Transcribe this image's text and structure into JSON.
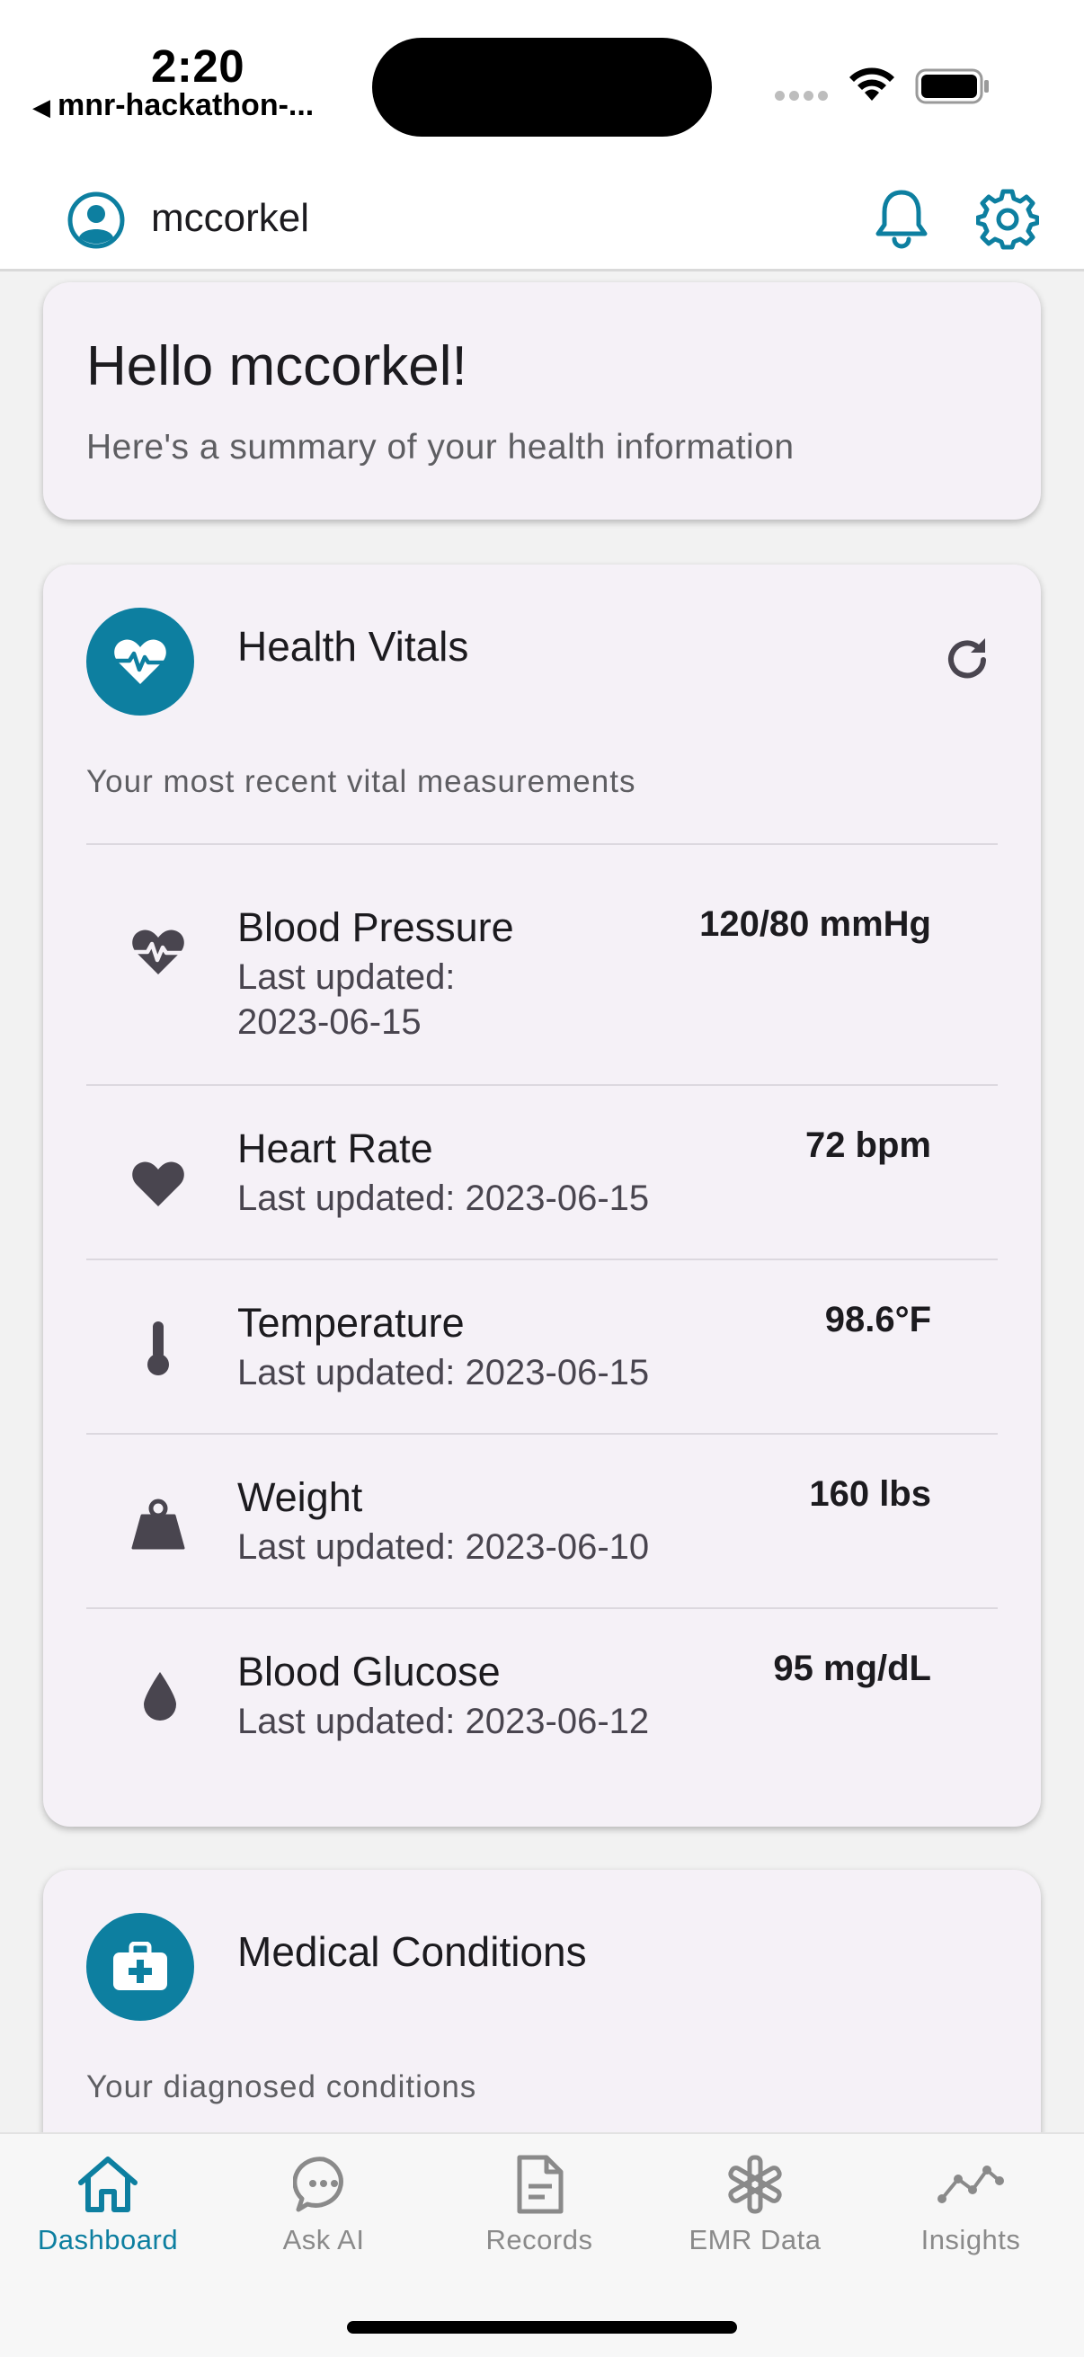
{
  "status_bar": {
    "time": "2:20",
    "back_app": "mnr-hackathon-..."
  },
  "header": {
    "username": "mccorkel"
  },
  "greeting": {
    "title": "Hello mccorkel!",
    "subtitle": "Here's a summary of your health information"
  },
  "vitals": {
    "title": "Health Vitals",
    "subtitle": "Your most recent vital measurements",
    "items": [
      {
        "name": "Blood Pressure",
        "updated_line1": "Last updated:",
        "updated_line2": "2023-06-15",
        "value": "120/80 mmHg",
        "icon": "heart-pulse-icon"
      },
      {
        "name": "Heart Rate",
        "updated": "Last updated: 2023-06-15",
        "value": "72 bpm",
        "icon": "heart-icon"
      },
      {
        "name": "Temperature",
        "updated": "Last updated: 2023-06-15",
        "value": "98.6°F",
        "icon": "thermometer-icon"
      },
      {
        "name": "Weight",
        "updated": "Last updated: 2023-06-10",
        "value": "160 lbs",
        "icon": "weight-icon"
      },
      {
        "name": "Blood Glucose",
        "updated": "Last updated: 2023-06-12",
        "value": "95 mg/dL",
        "icon": "drop-icon"
      }
    ]
  },
  "conditions": {
    "title": "Medical Conditions",
    "subtitle": "Your diagnosed conditions"
  },
  "nav": {
    "items": [
      {
        "label": "Dashboard",
        "icon": "home-icon",
        "active": true
      },
      {
        "label": "Ask AI",
        "icon": "chat-icon",
        "active": false
      },
      {
        "label": "Records",
        "icon": "document-icon",
        "active": false
      },
      {
        "label": "EMR Data",
        "icon": "asterisk-icon",
        "active": false
      },
      {
        "label": "Insights",
        "icon": "trend-icon",
        "active": false
      }
    ]
  },
  "colors": {
    "accent": "#0d7fa0",
    "card_bg": "#f5f1f7",
    "page_bg": "#f2f2f2",
    "inactive_nav": "#8a8a8a"
  }
}
